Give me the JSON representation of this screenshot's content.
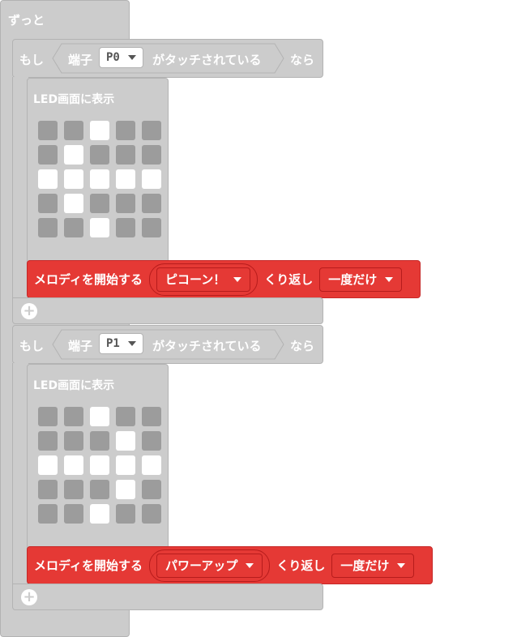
{
  "forever": {
    "label": "ずっと"
  },
  "if_blocks": [
    {
      "if_label": "もし",
      "pin_prefix": "端子",
      "pin_value": "P0",
      "touch_suffix": "がタッチされている",
      "then_label": "なら",
      "led_label": "LED画面に表示",
      "led_grid": [
        [
          0,
          0,
          1,
          0,
          0
        ],
        [
          0,
          1,
          0,
          0,
          0
        ],
        [
          1,
          1,
          1,
          1,
          1
        ],
        [
          0,
          1,
          0,
          0,
          0
        ],
        [
          0,
          0,
          1,
          0,
          0
        ]
      ],
      "melody_label": "メロディを開始する",
      "melody_value": "ピコーン！",
      "repeat_label": "くり返し",
      "repeat_value": "一度だけ"
    },
    {
      "if_label": "もし",
      "pin_prefix": "端子",
      "pin_value": "P1",
      "touch_suffix": "がタッチされている",
      "then_label": "なら",
      "led_label": "LED画面に表示",
      "led_grid": [
        [
          0,
          0,
          1,
          0,
          0
        ],
        [
          0,
          0,
          0,
          1,
          0
        ],
        [
          1,
          1,
          1,
          1,
          1
        ],
        [
          0,
          0,
          0,
          1,
          0
        ],
        [
          0,
          0,
          1,
          0,
          0
        ]
      ],
      "melody_label": "メロディを開始する",
      "melody_value": "パワーアップ",
      "repeat_label": "くり返し",
      "repeat_value": "一度だけ"
    }
  ],
  "colors": {
    "block_gray": "#cccccc",
    "led_off": "#9c9c9c",
    "led_on": "#ffffff",
    "melody_red": "#e53935"
  }
}
